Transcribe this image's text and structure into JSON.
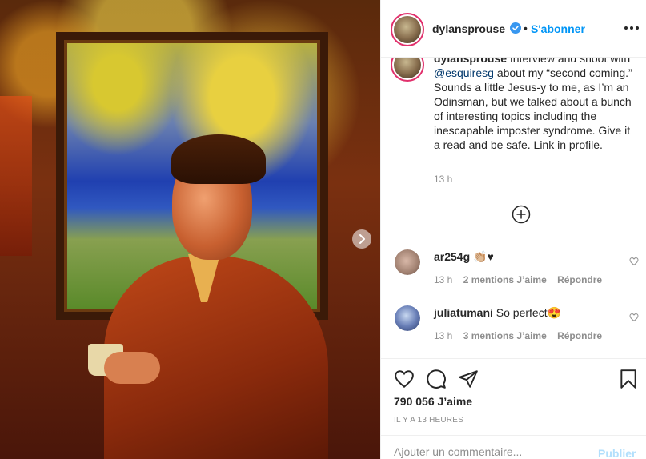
{
  "post": {
    "username": "dylansprouse",
    "follow_label": "S'abonner",
    "dot": "•",
    "caption_username": "dylansprouse",
    "caption_line1_rest": "Interview and shoot",
    "caption_prefix": "with",
    "caption_mention": "@esquiresg",
    "caption_body": "about my “second coming.” Sounds a little Jesus-y to me, as I’m an Odinsman, but we talked about a bunch of interesting topics including the inescapable imposter syndrome. Give it a read and be safe. Link in profile.",
    "caption_time": "13 h",
    "likes": "790 056 J’aime",
    "posted": "IL Y A 13 HEURES"
  },
  "comments": [
    {
      "username": "ar254g",
      "text": "👏🏼♥",
      "time": "13 h",
      "likes": "2 mentions J’aime",
      "reply": "Répondre"
    },
    {
      "username": "juliatumani",
      "text": "So perfect😍",
      "time": "13 h",
      "likes": "3 mentions J’aime",
      "reply": "Répondre"
    }
  ],
  "composer": {
    "placeholder": "Ajouter un commentaire...",
    "publish_label": "Publier"
  },
  "colors": {
    "accent": "#0095f6",
    "verified": "#3897f0",
    "text": "#262626",
    "muted": "#8e8e8e"
  },
  "icons": [
    "chevron-right-icon",
    "verified-icon",
    "more-icon",
    "plus-circle-icon",
    "heart-icon",
    "comment-icon",
    "share-icon",
    "bookmark-icon"
  ]
}
